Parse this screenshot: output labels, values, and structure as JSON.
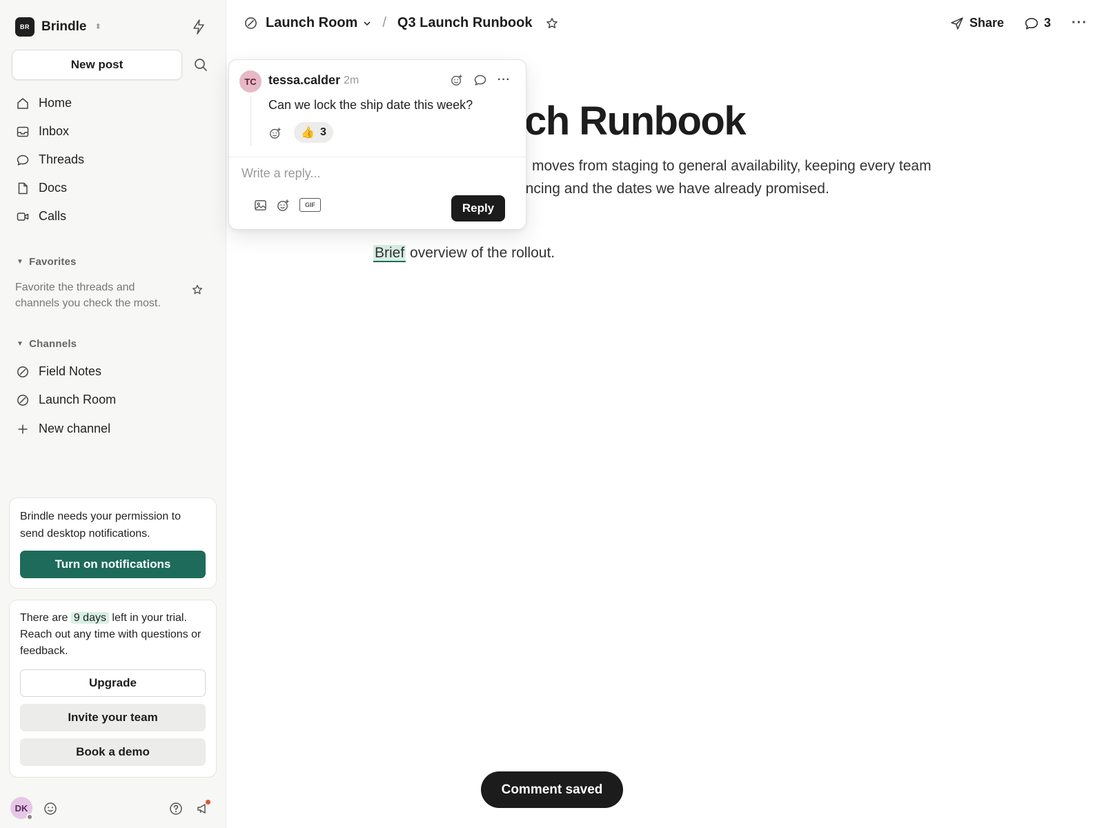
{
  "workspace": {
    "initials": "BR",
    "name": "Brindle"
  },
  "sidebar": {
    "new_post": "New post",
    "nav": [
      {
        "label": "Home",
        "icon": "home-icon"
      },
      {
        "label": "Inbox",
        "icon": "inbox-icon"
      },
      {
        "label": "Threads",
        "icon": "chat-bubble-icon"
      },
      {
        "label": "Docs",
        "icon": "document-icon"
      },
      {
        "label": "Calls",
        "icon": "video-icon"
      }
    ],
    "favorites": {
      "heading": "Favorites",
      "empty_text": "Favorite the threads and channels you check the most."
    },
    "channels": {
      "heading": "Channels",
      "items": [
        {
          "label": "Field Notes"
        },
        {
          "label": "Launch Room"
        }
      ],
      "new_channel": "New channel"
    },
    "notification_card": {
      "text": "Brindle needs your permission to send desktop notifications.",
      "button": "Turn on notifications"
    },
    "trial_card": {
      "text_before": "There are",
      "days": "9 days",
      "text_after": "left in your trial. Reach out any time with questions or feedback.",
      "upgrade": "Upgrade",
      "invite": "Invite your team",
      "demo": "Book a demo"
    },
    "user": {
      "initials": "DK"
    }
  },
  "topbar": {
    "channel": "Launch Room",
    "separator": "/",
    "doc_title": "Q3 Launch Runbook",
    "share": "Share",
    "comment_count": "3"
  },
  "document": {
    "title_visible": "ch Runbook",
    "para_line1": "moves from staging to general availability, keeping every team",
    "para_line2": "encing and the dates we have already promised.",
    "brief_highlight": "Brief",
    "brief_rest": " overview of the rollout."
  },
  "comment": {
    "initials": "TC",
    "author": "tessa.calder",
    "time": "2m",
    "text": "Can we lock the ship date this week?",
    "reaction_emoji": "👍",
    "reaction_count": "3",
    "reply_placeholder": "Write a reply...",
    "gif_label": "GIF",
    "reply_button": "Reply"
  },
  "toast": {
    "text": "Comment saved"
  },
  "colors": {
    "accent": "#1e6b5b",
    "highlight": "#d8efe4",
    "dark": "#1c1c1c"
  }
}
